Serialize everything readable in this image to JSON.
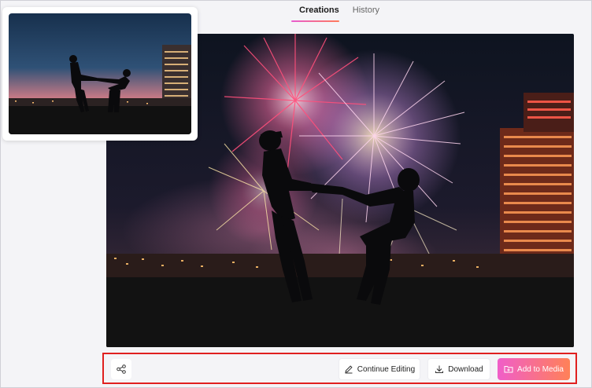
{
  "tabs": [
    {
      "label": "Creations",
      "active": true
    },
    {
      "label": "History",
      "active": false
    }
  ],
  "actions": {
    "share_icon": "share-icon",
    "continue_label": "Continue Editing",
    "download_label": "Download",
    "add_label": "Add to Media"
  },
  "colors": {
    "accent_gradient_start": "#f05ec9",
    "accent_gradient_end": "#ff8157",
    "highlight_border": "#e0201f"
  }
}
